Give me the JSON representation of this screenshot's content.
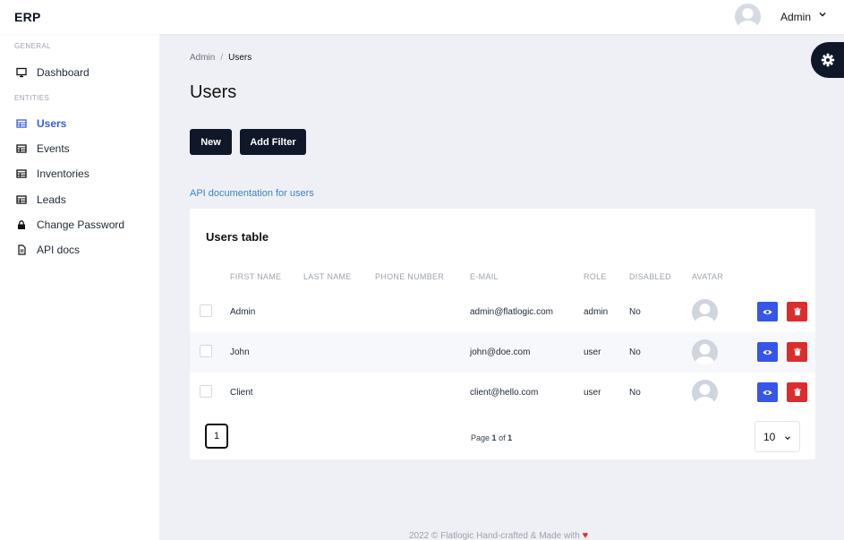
{
  "header": {
    "logo": "ERP",
    "user_name": "Admin"
  },
  "sidebar": {
    "section_general": "GENERAL",
    "section_entities": "ENTITIES",
    "items": [
      {
        "label": "Dashboard",
        "icon": "monitor-icon"
      },
      {
        "label": "Users",
        "icon": "table-icon",
        "active": true
      },
      {
        "label": "Events",
        "icon": "table-icon"
      },
      {
        "label": "Inventories",
        "icon": "table-icon"
      },
      {
        "label": "Leads",
        "icon": "table-icon"
      },
      {
        "label": "Change Password",
        "icon": "lock-icon"
      },
      {
        "label": "API docs",
        "icon": "file-icon"
      }
    ]
  },
  "breadcrumb": {
    "root": "Admin",
    "separator": "/",
    "current": "Users"
  },
  "page": {
    "title": "Users",
    "new_button": "New",
    "add_filter_button": "Add Filter",
    "api_link": "API documentation for users"
  },
  "table": {
    "title": "Users table",
    "columns": [
      "FIRST NAME",
      "LAST NAME",
      "PHONE NUMBER",
      "E-MAIL",
      "ROLE",
      "DISABLED",
      "AVATAR"
    ],
    "rows": [
      {
        "first_name": "Admin",
        "last_name": "",
        "phone": "",
        "email": "admin@flatlogic.com",
        "role": "admin",
        "disabled": "No"
      },
      {
        "first_name": "John",
        "last_name": "",
        "phone": "",
        "email": "john@doe.com",
        "role": "user",
        "disabled": "No"
      },
      {
        "first_name": "Client",
        "last_name": "",
        "phone": "",
        "email": "client@hello.com",
        "role": "user",
        "disabled": "No"
      }
    ]
  },
  "pagination": {
    "current_page": "1",
    "page_prefix": "Page",
    "page_num": "1",
    "of_word": "of",
    "page_total": "1",
    "per_page": "10"
  },
  "footer": {
    "text": "2022 © Flatlogic Hand-crafted & Made with",
    "heart": "♥"
  },
  "colors": {
    "accent": "#3b5bdb",
    "dark": "#0f1729",
    "view": "#3556e8",
    "delete": "#dc2d2d",
    "link": "#3b82c4"
  }
}
